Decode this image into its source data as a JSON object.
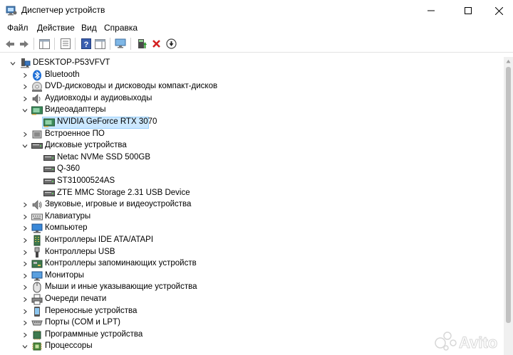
{
  "window": {
    "title": "Диспетчер устройств"
  },
  "menu": [
    "Файл",
    "Действие",
    "Вид",
    "Справка"
  ],
  "tree": {
    "root": "DESKTOP-P53VFVT",
    "items": [
      {
        "label": "Bluetooth",
        "icon": "bluetooth-icon",
        "expanded": false
      },
      {
        "label": "DVD-дисководы и дисководы компакт-дисков",
        "icon": "dvd-drive-icon",
        "expanded": false
      },
      {
        "label": "Аудиовходы и аудиовыходы",
        "icon": "audio-io-icon",
        "expanded": false
      },
      {
        "label": "Видеоадаптеры",
        "icon": "display-adapter-icon",
        "expanded": true,
        "children": [
          {
            "label": "NVIDIA GeForce RTX 3070",
            "icon": "display-adapter-icon",
            "selected": true
          }
        ]
      },
      {
        "label": "Встроенное ПО",
        "icon": "firmware-icon",
        "expanded": false
      },
      {
        "label": "Дисковые устройства",
        "icon": "disk-drive-icon",
        "expanded": true,
        "children": [
          {
            "label": "Netac NVMe SSD 500GB",
            "icon": "disk-drive-icon"
          },
          {
            "label": "Q-360",
            "icon": "disk-drive-icon"
          },
          {
            "label": "ST31000524AS",
            "icon": "disk-drive-icon"
          },
          {
            "label": "ZTE MMC Storage 2.31 USB Device",
            "icon": "disk-drive-icon"
          }
        ]
      },
      {
        "label": "Звуковые, игровые и видеоустройства",
        "icon": "sound-icon",
        "expanded": false
      },
      {
        "label": "Клавиатуры",
        "icon": "keyboard-icon",
        "expanded": false
      },
      {
        "label": "Компьютер",
        "icon": "computer-icon",
        "expanded": false
      },
      {
        "label": "Контроллеры IDE ATA/ATAPI",
        "icon": "ide-controller-icon",
        "expanded": false
      },
      {
        "label": "Контроллеры USB",
        "icon": "usb-icon",
        "expanded": false
      },
      {
        "label": "Контроллеры запоминающих устройств",
        "icon": "storage-controller-icon",
        "expanded": false
      },
      {
        "label": "Мониторы",
        "icon": "monitor-icon",
        "expanded": false
      },
      {
        "label": "Мыши и иные указывающие устройства",
        "icon": "mouse-icon",
        "expanded": false
      },
      {
        "label": "Очереди печати",
        "icon": "printer-icon",
        "expanded": false
      },
      {
        "label": "Переносные устройства",
        "icon": "portable-device-icon",
        "expanded": false
      },
      {
        "label": "Порты (COM и LPT)",
        "icon": "port-icon",
        "expanded": false
      },
      {
        "label": "Программные устройства",
        "icon": "software-device-icon",
        "expanded": false
      },
      {
        "label": "Процессоры",
        "icon": "processor-icon",
        "expanded": true
      }
    ]
  },
  "watermark": {
    "text": "Avito"
  }
}
